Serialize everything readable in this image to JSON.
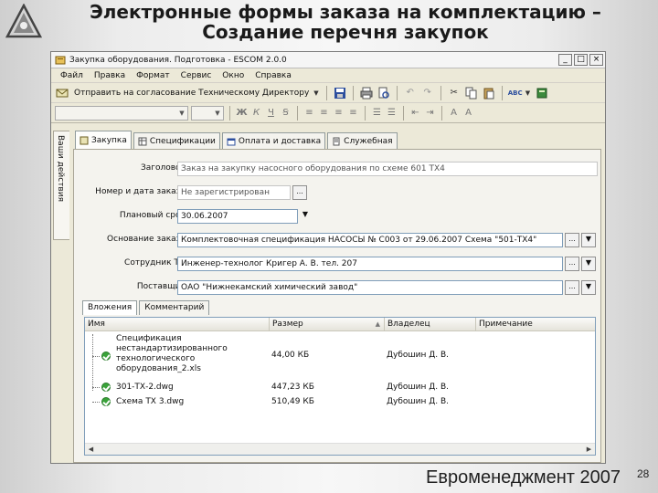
{
  "slide": {
    "title_line1": "Электронные формы заказа на комплектацию –",
    "title_line2": "Создание перечня закупок",
    "footer_brand": "Евроменеджмент 2007",
    "page_number": "28"
  },
  "window": {
    "title": "Закупка оборудования. Подготовка - ESCOM 2.0.0",
    "buttons": [
      "_",
      "□",
      "×"
    ]
  },
  "menu": [
    "Файл",
    "Правка",
    "Формат",
    "Сервис",
    "Окно",
    "Справка"
  ],
  "toolbar": {
    "send_label": "Отправить на согласование Техническому Директору"
  },
  "side_tab": "Ваши действия",
  "tabs": [
    {
      "label": "Закупка",
      "active": true
    },
    {
      "label": "Спецификации",
      "active": false
    },
    {
      "label": "Оплата и доставка",
      "active": false
    },
    {
      "label": "Служебная",
      "active": false
    }
  ],
  "form": {
    "title_label": "Заголовок:",
    "title_value": "Заказ на закупку насосного оборудования по схеме 601 ТХ4",
    "number_label": "Номер и дата заказа:",
    "number_value": "Не зарегистрирован",
    "deadline_label": "Плановый срок:",
    "deadline_value": "30.06.2007",
    "basis_label": "Основание заказа:",
    "basis_value": "Комплектовочная спецификация НАСОСЫ № С003 от 29.06.2007 Схема \"501-ТХ4\"",
    "employee_label": "Сотрудник ТО:",
    "employee_value": "Инженер-технолог Кригер А. В. тел. 207",
    "supplier_label": "Поставщик:",
    "supplier_value": "ОАО \"Нижнекамский химический завод\"",
    "ellipsis": "...",
    "dropdown": "▼"
  },
  "subtabs": [
    {
      "label": "Вложения",
      "active": true
    },
    {
      "label": "Комментарий",
      "active": false
    }
  ],
  "grid": {
    "columns": [
      "Имя",
      "Размер",
      "Владелец",
      "Примечание"
    ],
    "sort_indicator": "▲",
    "rows": [
      {
        "name": [
          "Спецификация",
          "нестандартизированного",
          "технологического",
          "оборудования_2.xls"
        ],
        "size": "44,00 КБ",
        "owner": "Дубошин Д. В.",
        "note": ""
      },
      {
        "name": [
          "301-ТХ-2.dwg"
        ],
        "size": "447,23 КБ",
        "owner": "Дубошин Д. В.",
        "note": ""
      },
      {
        "name": [
          "Схема ТХ 3.dwg"
        ],
        "size": "510,49 КБ",
        "owner": "Дубошин Д. В.",
        "note": ""
      }
    ]
  }
}
